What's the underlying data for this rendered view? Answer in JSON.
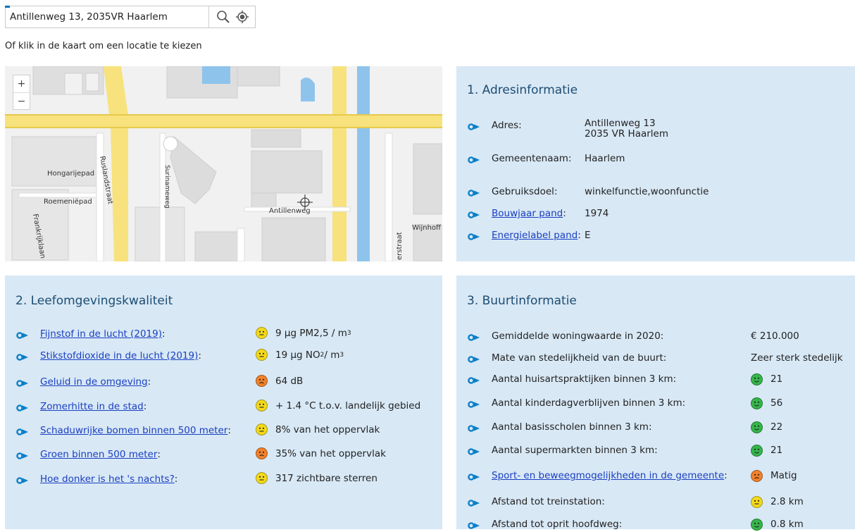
{
  "search": {
    "value": "Antillenweg 13, 2035VR Haarlem",
    "hint": "Of klik in de kaart om een locatie te kiezen"
  },
  "map": {
    "zoom_in": "+",
    "zoom_out": "−",
    "streets": [
      "Hongarijepad",
      "Ruslandstraat",
      "Roemeniëpad",
      "Frankrijklaan",
      "Surinameweg",
      "Antillenweg",
      "Wijnhoff",
      "erstraat"
    ]
  },
  "panel1": {
    "title": "1. Adresinformatie",
    "rows": [
      {
        "label": "Adres:",
        "value_line1": "Antillenweg 13",
        "value_line2": "2035 VR  Haarlem"
      },
      {
        "label": "Gemeentenaam:",
        "value": "Haarlem"
      },
      {
        "label": "Gebruiksdoel:",
        "value": "winkelfunctie,woonfunctie"
      },
      {
        "label": "Bouwjaar pand",
        "suffix": ":",
        "value": "1974"
      },
      {
        "label": "Energielabel pand",
        "suffix": ":",
        "value": "E"
      }
    ]
  },
  "panel2": {
    "title": "2. Leefomgevingskwaliteit",
    "rows": [
      {
        "label": "Fijnstof in de lucht (2019)",
        "suffix": ":",
        "face": "yellow",
        "value_pre": "9 µg PM2,5 / m",
        "value_sup": "3"
      },
      {
        "label": "Stikstofdioxide in de lucht (2019)",
        "suffix": ":",
        "face": "yellow",
        "value_pre": "19 µg NO",
        "value_sub": "2",
        "value_mid": " / m",
        "value_sup": "3"
      },
      {
        "label": "Geluid in de omgeving",
        "suffix": ":",
        "face": "orange",
        "value": "64 dB"
      },
      {
        "label": "Zomerhitte in de stad",
        "suffix": ":",
        "face": "yellow",
        "value": "+ 1.4 °C t.o.v. landelijk gebied"
      },
      {
        "label": "Schaduwrijke bomen binnen 500 meter",
        "suffix": ":",
        "face": "yellow",
        "value": "8% van het oppervlak"
      },
      {
        "label": "Groen binnen 500 meter",
        "suffix": ":",
        "face": "orange",
        "value": "35% van het oppervlak"
      },
      {
        "label": "Hoe donker is het 's nachts?",
        "suffix": ":",
        "face": "yellow",
        "value": "317 zichtbare sterren"
      }
    ]
  },
  "panel3": {
    "title": "3. Buurtinformatie",
    "rows": [
      {
        "label": "Gemiddelde woningwaarde in 2020:",
        "value": "€ 210.000"
      },
      {
        "label": "Mate van stedelijkheid van de buurt:",
        "value": "Zeer sterk stedelijk"
      },
      {
        "label": "Aantal huisartspraktijken binnen 3 km:",
        "face": "green",
        "value": "21"
      },
      {
        "label": "Aantal kinderdagverblijven binnen 3 km:",
        "face": "green",
        "value": "56"
      },
      {
        "label": "Aantal basisscholen binnen 3 km:",
        "face": "green",
        "value": "22"
      },
      {
        "label": "Aantal supermarkten binnen 3 km:",
        "face": "green",
        "value": "21"
      },
      {
        "label": "Sport- en beweegmogelijkheden in de gemeente",
        "suffix": ":",
        "face": "orange",
        "value": "Matig",
        "link": true
      },
      {
        "label": "Afstand tot treinstation:",
        "face": "yellow",
        "value": "2.8 km"
      },
      {
        "label": "Afstand tot oprit hoofdweg:",
        "face": "green",
        "value": "0.8 km"
      }
    ]
  },
  "colors": {
    "panel_bg": "#d8e8f5",
    "title": "#1d4d73",
    "link": "#1a3fc2",
    "bullet": "#0a7fc8",
    "yellow": "#f3d91a",
    "orange": "#f2812b",
    "green": "#35b64a"
  }
}
